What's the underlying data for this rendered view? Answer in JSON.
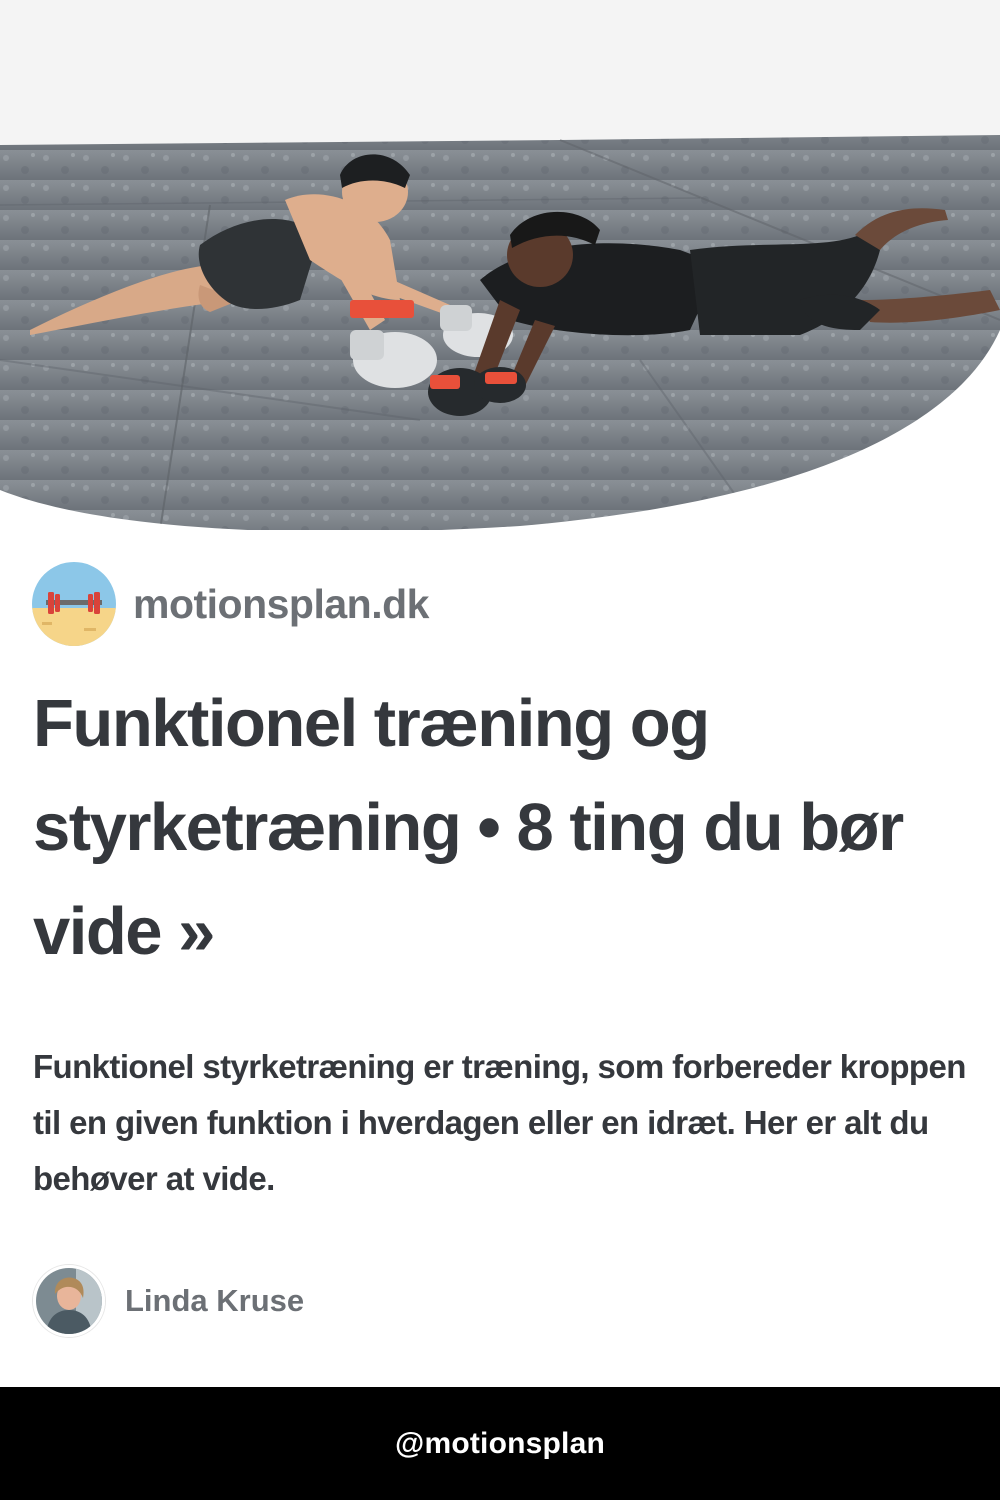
{
  "hero": {
    "image": "boxing-photo",
    "alt_icon": "two-men-boxing-on-floor-image"
  },
  "site": {
    "logo_icon": "dumbbell-beach-logo",
    "name": "motionsplan.dk"
  },
  "article": {
    "title": "Funktionel træning og styrketræning • 8 ting du bør vide »",
    "description": "Funktionel styrketræning er træning, som forbereder kroppen til en given funktion i hverdagen eller en idræt. Her er alt du behøver at vide."
  },
  "author": {
    "avatar_icon": "author-avatar",
    "name": "Linda Kruse"
  },
  "footer": {
    "handle": "@motionsplan"
  },
  "colors": {
    "text_dark": "#35383d",
    "text_muted": "#6c7075",
    "footer_bg": "#000000",
    "footer_text": "#ffffff",
    "glove_accent": "#e8503a"
  }
}
